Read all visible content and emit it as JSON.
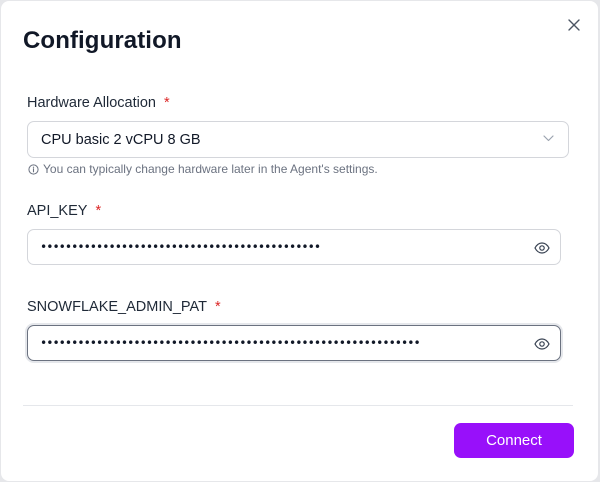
{
  "dialog": {
    "title": "Configuration",
    "colors": {
      "accent": "#9810fa",
      "required": "#dc2626",
      "hint": "#6b7280"
    }
  },
  "hardware": {
    "label": "Hardware Allocation",
    "required_mark": "*",
    "selected": "CPU basic 2 vCPU 8 GB",
    "hint": "You can typically change hardware later in the Agent's settings."
  },
  "api_key": {
    "label": "API_KEY",
    "required_mark": "*",
    "value": "sk-0123456789abcdef0123456789abcdef0123456789"
  },
  "snowflake": {
    "label": "SNOWFLAKE_ADMIN_PAT",
    "required_mark": "*",
    "value": "pat-0123456789abcdef0123456789abcdef0123456789abcdef012345678"
  },
  "footer": {
    "connect_label": "Connect"
  },
  "icons": {
    "close": "close-icon",
    "chevron": "chevron-down-icon",
    "info": "info-icon",
    "eye": "eye-icon"
  }
}
